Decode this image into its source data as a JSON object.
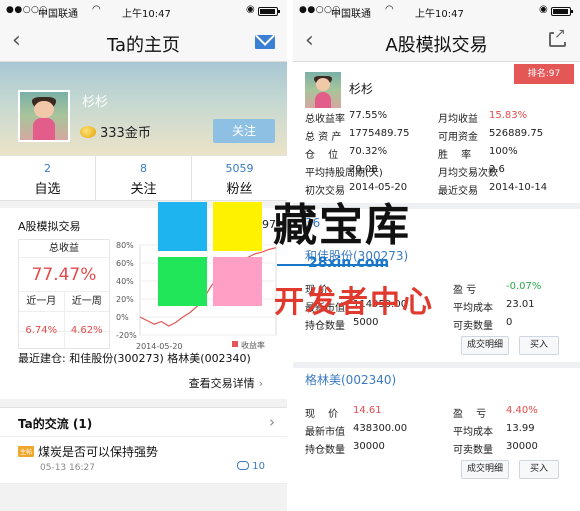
{
  "status": {
    "carrier": "中国联通",
    "time": "上午10:47"
  },
  "left": {
    "nav_title": "Ta的主页",
    "username": "杉杉",
    "coins": "333金币",
    "follow_label": "关注",
    "stats": [
      {
        "num": "2",
        "label": "自选"
      },
      {
        "num": "8",
        "label": "关注"
      },
      {
        "num": "5059",
        "label": "粉丝"
      }
    ],
    "trade": {
      "title": "A股模拟交易",
      "partial_value": "97",
      "total_return_label": "总收益",
      "total_return_value": "77.47%",
      "month_label": "近一月",
      "week_label": "近一周",
      "month_value": "6.74%",
      "week_value": "4.62%",
      "recent_label": "最近建仓: 和佳股份(300273) 格林美(002340)",
      "detail_label": "查看交易详情"
    },
    "talk": {
      "title": "Ta的交流 (1)",
      "tag": "主帖",
      "text": "煤炭是否可以保持强势",
      "time": "05-13 16:27",
      "comments": "10"
    }
  },
  "chart_data": {
    "type": "line",
    "x": [
      "2014-05-20"
    ],
    "yticks": [
      "80%",
      "60%",
      "40%",
      "20%",
      "0%",
      "-20%"
    ],
    "ylim": [
      -20,
      80
    ],
    "legend": "收益率",
    "legend_color": "#e55656",
    "series": [
      {
        "name": "收益率",
        "values": [
          0,
          -4,
          -8,
          -5,
          -10,
          -6,
          0,
          5,
          12,
          22,
          35,
          45,
          52,
          58,
          62,
          66,
          70,
          72,
          75,
          77
        ]
      }
    ]
  },
  "right": {
    "nav_title": "A股模拟交易",
    "username": "杉杉",
    "rank": "排名:97",
    "overview": [
      {
        "k": "总收益率",
        "v": "77.55%",
        "k2": "月均收益",
        "v2": "15.83%"
      },
      {
        "k": "总 资 产",
        "v": "1775489.75",
        "k2": "可用资金",
        "v2": "526889.75"
      },
      {
        "k": "仓　 位",
        "v": "70.32%",
        "k2": "胜　 率",
        "v2": "100%"
      },
      {
        "k": "平均持股周期(天)",
        "v": "20.08",
        "k2": "月均交易次数",
        "v2": "2.6"
      },
      {
        "k": "初次交易",
        "v": "2014-05-20",
        "k2": "最近交易",
        "v2": "2014-10-14"
      }
    ],
    "positions": [
      {
        "name": "和佳股份(300273)",
        "price_label": "现 价",
        "price": "",
        "profit_label": "盈 亏",
        "profit": "-0.07%",
        "mv_label": "最新市值",
        "mv": "114950.00",
        "cost_label": "平均成本",
        "cost": "23.01",
        "qty_label": "持仓数量",
        "qty": "5000",
        "sell_label": "可卖数量",
        "sell": "0",
        "btn_detail": "成交明细",
        "btn_buy": "买入"
      },
      {
        "name": "格林美(002340)",
        "price_label": "现　 价",
        "price": "14.61",
        "profit_label": "盈　 亏",
        "profit": "4.40%",
        "mv_label": "最新市值",
        "mv": "438300.00",
        "cost_label": "平均成本",
        "cost": "13.99",
        "qty_label": "持仓数量",
        "qty": "30000",
        "sell_label": "可卖数量",
        "sell": "30000",
        "btn_detail": "成交明细",
        "btn_buy": "买入"
      }
    ],
    "partial_value": "36"
  },
  "watermark": {
    "title": "藏宝库",
    "url": "28xin.com",
    "subtitle": "开发者中心",
    "colors": [
      "#1eb4f0",
      "#fff200",
      "#22e65a",
      "#ff9fc6"
    ]
  }
}
